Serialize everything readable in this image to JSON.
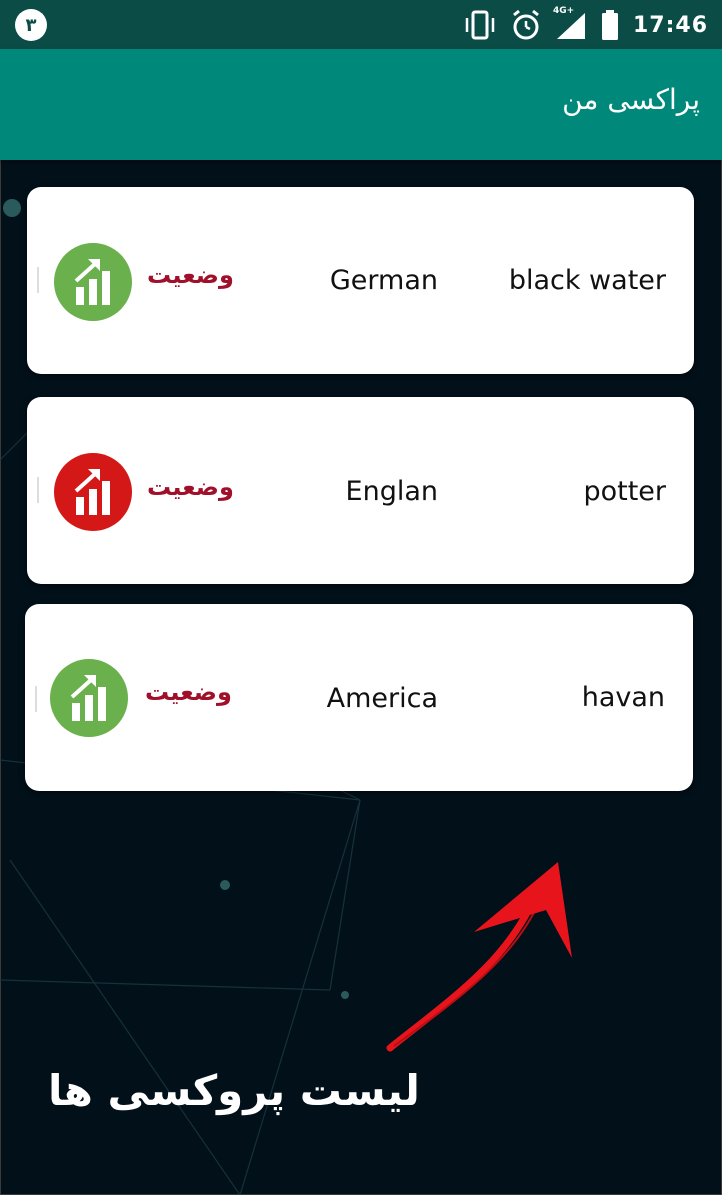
{
  "status_bar": {
    "notification_badge": "٣",
    "network": "4G+",
    "time": "17:46"
  },
  "app_bar": {
    "title": "پراکسی من"
  },
  "proxies": [
    {
      "name": "black water",
      "country": "German",
      "status_label": "وضعیت",
      "status_color": "#6ab04c"
    },
    {
      "name": "potter",
      "country": "Englan",
      "status_label": "وضعیت",
      "status_color": "#d41818"
    },
    {
      "name": "havan",
      "country": "America",
      "status_label": "وضعیت",
      "status_color": "#6ab04c"
    }
  ],
  "caption": "لیست پروکسی ها",
  "colors": {
    "app_bar": "#00887a",
    "status_bar": "#0b4d46",
    "arrow": "#e8141c"
  }
}
